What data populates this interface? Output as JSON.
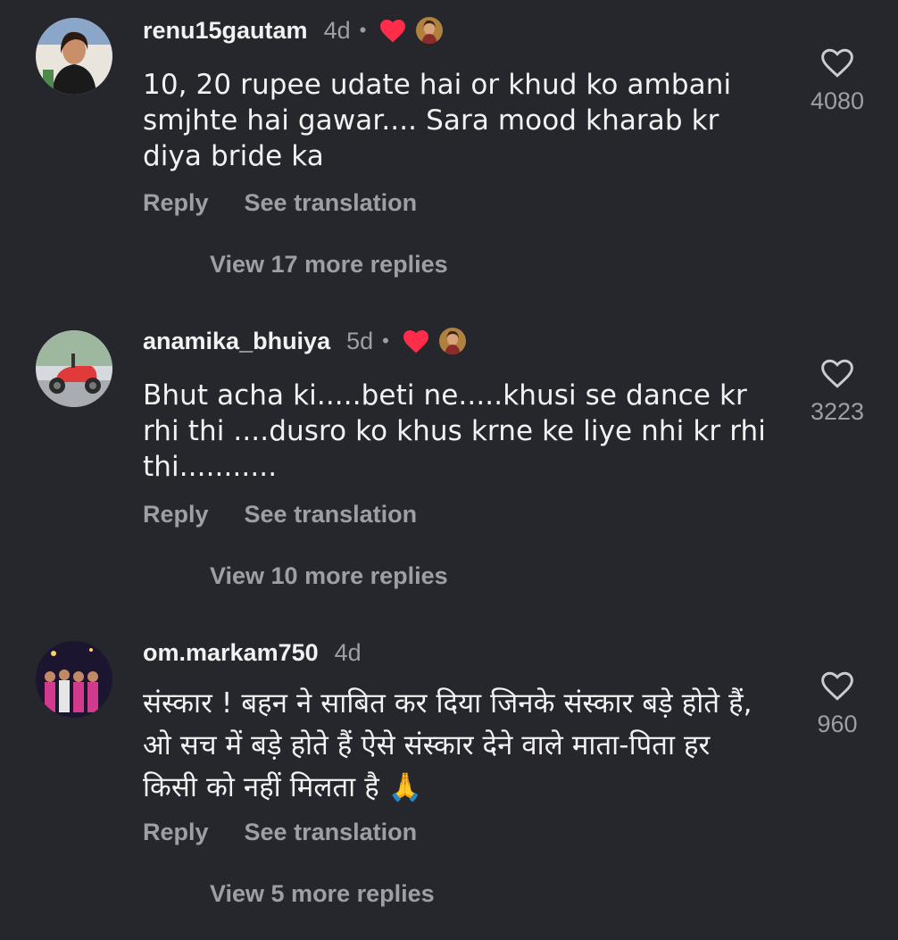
{
  "comments": [
    {
      "username": "renu15gautam",
      "time": "4d",
      "liked_by_creator": true,
      "text": "10, 20 rupee udate hai or khud ko ambani smjhte hai gawar.... Sara mood kharab kr diya bride ka",
      "reply_label": "Reply",
      "translate_label": "See translation",
      "view_more": "View 17 more replies",
      "likes": "4080"
    },
    {
      "username": "anamika_bhuiya",
      "time": "5d",
      "liked_by_creator": true,
      "text": "Bhut acha ki.....beti ne.....khusi se dance kr rhi thi ....dusro ko khus krne ke liye nhi kr rhi thi...........",
      "reply_label": "Reply",
      "translate_label": "See translation",
      "view_more": "View 10 more replies",
      "likes": "3223"
    },
    {
      "username": "om.markam750",
      "time": "4d",
      "liked_by_creator": false,
      "text": "संस्कार ! बहन ने साबित कर दिया जिनके संस्कार बड़े होते हैं, ओ सच में बड़े होते हैं ऐसे संस्कार देने वाले माता-पिता हर किसी को नहीं मिलता है",
      "emoji": "🙏",
      "reply_label": "Reply",
      "translate_label": "See translation",
      "view_more": "View 5 more replies",
      "likes": "960"
    }
  ],
  "colors": {
    "background": "#25272c",
    "primary_text": "#f2f2f2",
    "secondary_text": "#9ca0a6",
    "heart_red": "#ff2d4a"
  },
  "icons": {
    "like": "heart-outline-icon",
    "creator_like": "heart-filled-icon",
    "dot": "•"
  }
}
